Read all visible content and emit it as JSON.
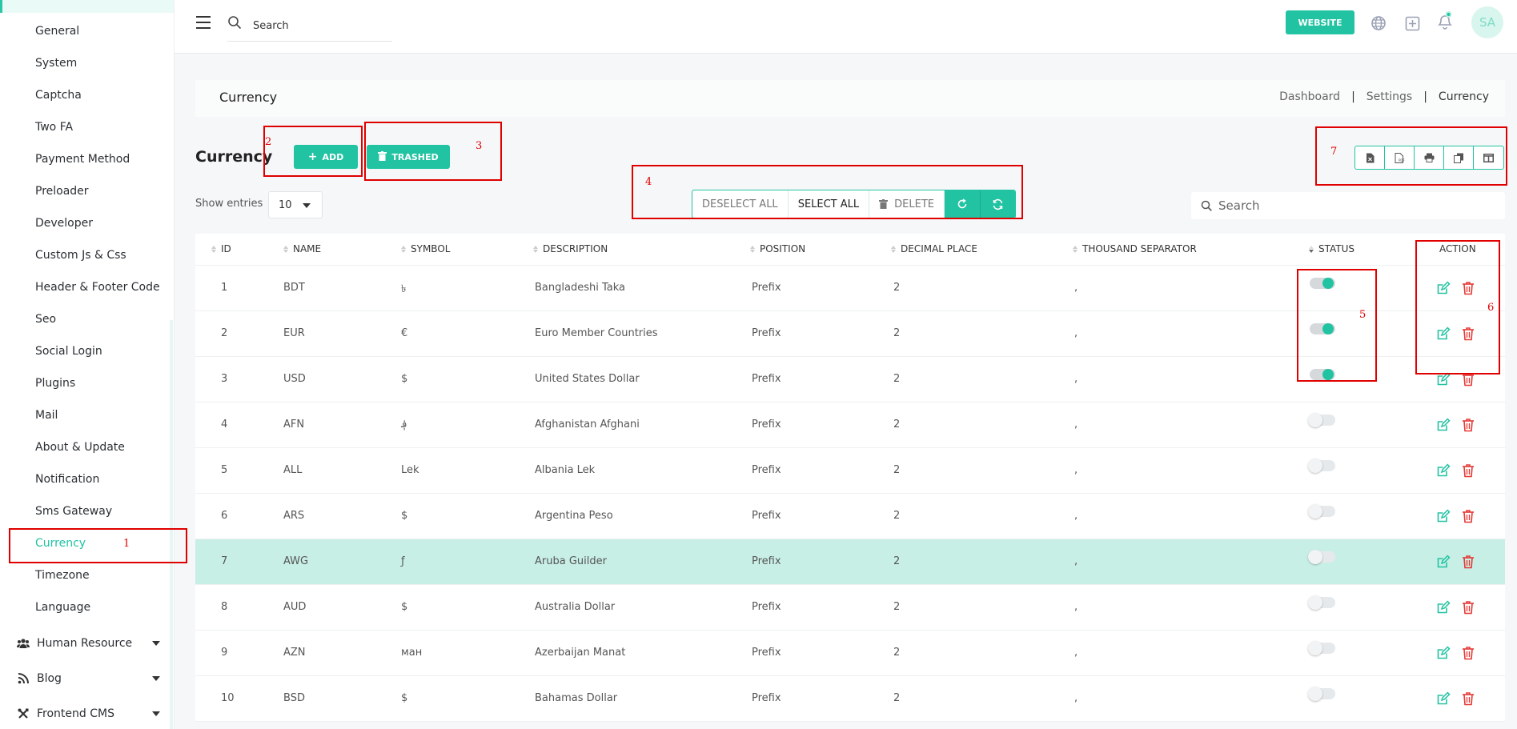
{
  "sidebar": {
    "items": [
      {
        "label": "General"
      },
      {
        "label": "System"
      },
      {
        "label": "Captcha"
      },
      {
        "label": "Two FA"
      },
      {
        "label": "Payment Method"
      },
      {
        "label": "Preloader"
      },
      {
        "label": "Developer"
      },
      {
        "label": "Custom Js & Css"
      },
      {
        "label": "Header & Footer Code"
      },
      {
        "label": "Seo"
      },
      {
        "label": "Social Login"
      },
      {
        "label": "Plugins"
      },
      {
        "label": "Mail"
      },
      {
        "label": "About & Update"
      },
      {
        "label": "Notification"
      },
      {
        "label": "Sms Gateway"
      },
      {
        "label": "Currency",
        "active": true
      },
      {
        "label": "Timezone"
      },
      {
        "label": "Language"
      }
    ],
    "groups": [
      {
        "label": "Human Resource",
        "icon": "users-icon"
      },
      {
        "label": "Blog",
        "icon": "rss-icon"
      },
      {
        "label": "Frontend CMS",
        "icon": "tools-icon"
      }
    ]
  },
  "topbar": {
    "search_placeholder": "Search",
    "website_label": "WEBSITE",
    "avatar_initials": "SA",
    "icons": [
      "globe-icon",
      "plus-square-icon",
      "bell-icon"
    ]
  },
  "page_header": {
    "title": "Currency",
    "breadcrumbs": [
      "Dashboard",
      "Settings",
      "Currency"
    ],
    "separator": "|"
  },
  "content": {
    "title": "Currency",
    "add_label": "ADD",
    "trashed_label": "TRASHED",
    "show_entries_label": "Show entries",
    "entries_value": "10",
    "bulk": {
      "deselect_all": "DESELECT ALL",
      "select_all": "SELECT ALL",
      "delete": "DELETE"
    },
    "search_placeholder": "Search",
    "export_icons": [
      "excel-icon",
      "pdf-icon",
      "print-icon",
      "copy-icon",
      "columns-icon"
    ]
  },
  "table": {
    "columns": [
      "ID",
      "NAME",
      "SYMBOL",
      "DESCRIPTION",
      "POSITION",
      "DECIMAL PLACE",
      "THOUSAND SEPARATOR",
      "STATUS",
      "ACTION"
    ],
    "rows": [
      {
        "id": "1",
        "name": "BDT",
        "symbol": "৳",
        "description": "Bangladeshi Taka",
        "position": "Prefix",
        "decimal": "2",
        "thousand": ",",
        "status": true
      },
      {
        "id": "2",
        "name": "EUR",
        "symbol": "€",
        "description": "Euro Member Countries",
        "position": "Prefix",
        "decimal": "2",
        "thousand": ",",
        "status": true
      },
      {
        "id": "3",
        "name": "USD",
        "symbol": "$",
        "description": "United States Dollar",
        "position": "Prefix",
        "decimal": "2",
        "thousand": ",",
        "status": true
      },
      {
        "id": "4",
        "name": "AFN",
        "symbol": "؋",
        "description": "Afghanistan Afghani",
        "position": "Prefix",
        "decimal": "2",
        "thousand": ",",
        "status": false
      },
      {
        "id": "5",
        "name": "ALL",
        "symbol": "Lek",
        "description": "Albania Lek",
        "position": "Prefix",
        "decimal": "2",
        "thousand": ",",
        "status": false
      },
      {
        "id": "6",
        "name": "ARS",
        "symbol": "$",
        "description": "Argentina Peso",
        "position": "Prefix",
        "decimal": "2",
        "thousand": ",",
        "status": false
      },
      {
        "id": "7",
        "name": "AWG",
        "symbol": "ƒ",
        "description": "Aruba Guilder",
        "position": "Prefix",
        "decimal": "2",
        "thousand": ",",
        "status": false,
        "highlighted": true
      },
      {
        "id": "8",
        "name": "AUD",
        "symbol": "$",
        "description": "Australia Dollar",
        "position": "Prefix",
        "decimal": "2",
        "thousand": ",",
        "status": false
      },
      {
        "id": "9",
        "name": "AZN",
        "symbol": "ман",
        "description": "Azerbaijan Manat",
        "position": "Prefix",
        "decimal": "2",
        "thousand": ",",
        "status": false
      },
      {
        "id": "10",
        "name": "BSD",
        "symbol": "$",
        "description": "Bahamas Dollar",
        "position": "Prefix",
        "decimal": "2",
        "thousand": ",",
        "status": false
      }
    ]
  },
  "annotations": [
    "1",
    "2",
    "3",
    "4",
    "5",
    "6",
    "7"
  ],
  "colors": {
    "accent": "#22c3a2",
    "danger": "#e53935",
    "annotation": "#e00000",
    "highlight_row": "#c8efe6"
  }
}
